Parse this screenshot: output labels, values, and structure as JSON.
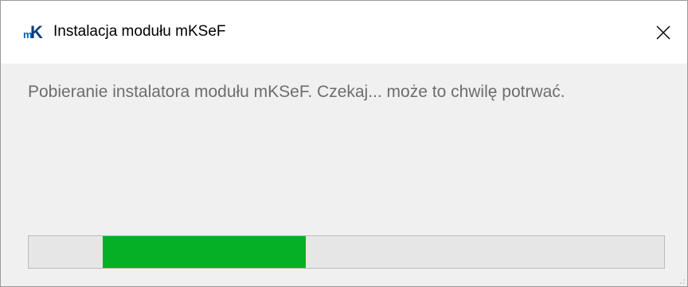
{
  "window": {
    "title": "Instalacja modułu mKSeF",
    "app_icon": "mk-logo-icon",
    "close_icon": "close-icon"
  },
  "content": {
    "message": "Pobieranie instalatora modułu mKSeF. Czekaj... może to chwilę potrwać."
  },
  "progress": {
    "mode": "marquee",
    "segment_start_fraction": 0.117,
    "segment_end_fraction": 0.436,
    "fill_color": "#06b025",
    "track_color": "#e6e6e6"
  },
  "colors": {
    "title_bg": "#ffffff",
    "body_bg": "#f0f0f0",
    "message_text": "#6d6d6d",
    "accent_blue": "#0063b1"
  }
}
